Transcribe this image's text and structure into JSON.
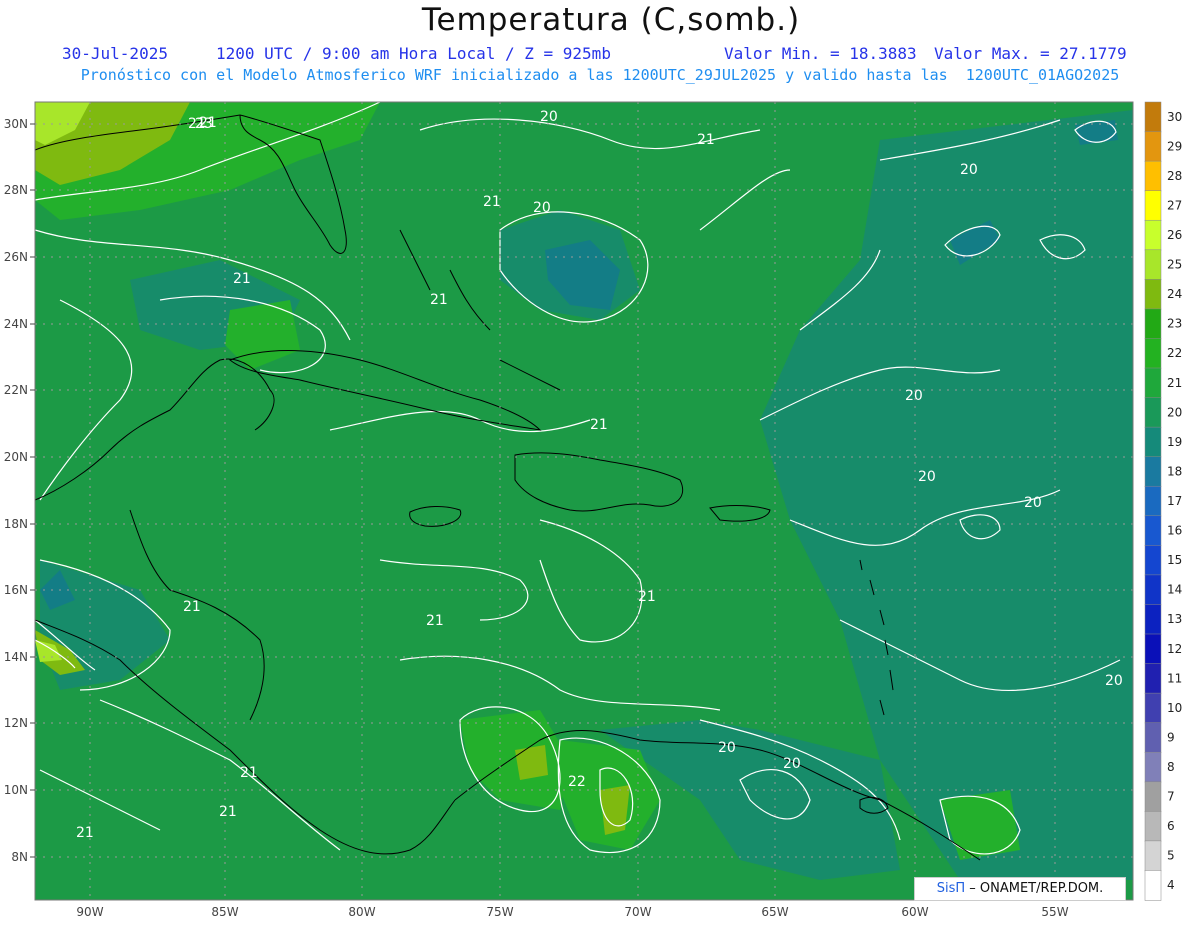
{
  "header": {
    "title": "Temperatura (C,somb.)",
    "date": "30-Jul-2025",
    "time": "1200 UTC / 9:00 am Hora Local / Z = 925mb",
    "min": "Valor Min. = 18.3883",
    "max": "Valor Max. = 27.1779",
    "forecast": "Pronóstico con el Modelo Atmosferico WRF inicializado a las 1200UTC_29JUL2025 y valido hasta las  1200UTC_01AGO2025"
  },
  "axes": {
    "lon_labels": [
      "90W",
      "85W",
      "80W",
      "75W",
      "70W",
      "65W",
      "60W",
      "55W"
    ],
    "lat_labels": [
      "30N",
      "28N",
      "26N",
      "24N",
      "22N",
      "20N",
      "18N",
      "16N",
      "14N",
      "12N",
      "10N",
      "8N"
    ]
  },
  "colorbar": {
    "labels": [
      "30",
      "29",
      "28",
      "27",
      "26",
      "25",
      "24",
      "23",
      "22",
      "21",
      "20",
      "19",
      "18",
      "17",
      "16",
      "15",
      "14",
      "13",
      "12",
      "11",
      "10",
      "9",
      "8",
      "7",
      "6",
      "5",
      "4"
    ],
    "colors": [
      "#c27b0c",
      "#e3960f",
      "#ffbf00",
      "#ffff00",
      "#c8ff2c",
      "#a8e62a",
      "#7fba10",
      "#22a915",
      "#23b221",
      "#1fa83b",
      "#1a9959",
      "#158a7a",
      "#1a7aa0",
      "#1a6ac0",
      "#1858d0",
      "#1446d0",
      "#1034c8",
      "#0c22c0",
      "#0a10b8",
      "#2020b0",
      "#4040b0",
      "#6060b0",
      "#8080b8",
      "#a0a0a0",
      "#b8b8b8",
      "#d4d4d4",
      "#ffffff"
    ]
  },
  "contour_labels": [
    "21",
    "23",
    "21",
    "20",
    "21",
    "21",
    "21",
    "20",
    "21",
    "20",
    "20",
    "21",
    "21",
    "21",
    "20",
    "20",
    "22",
    "20",
    "21",
    "21",
    "21",
    "21",
    "20",
    "20"
  ],
  "footer": {
    "logo_brand": "SisΠ",
    "logo_org": "– ONAMET/REP.DOM."
  }
}
